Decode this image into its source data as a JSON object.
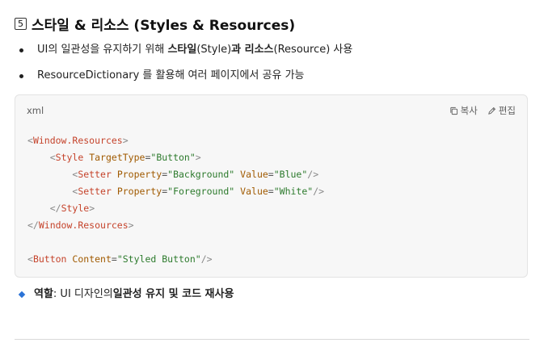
{
  "section": {
    "number": "5",
    "title": "스타일 & 리소스 (Styles & Resources)"
  },
  "bullets": [
    {
      "pre": "UI의 일관성을 유지하기 위해 ",
      "bold": "스타일",
      "mid1": "(Style)",
      "and": "과 ",
      "bold2": "리소스",
      "post": "(Resource) 사용"
    },
    {
      "text": "ResourceDictionary 를 활용해 여러 페이지에서 공유 가능"
    }
  ],
  "code": {
    "language": "xml",
    "copy_label": "복사",
    "edit_label": "편집",
    "lines": [
      {
        "indent": "",
        "open": "<",
        "tag": "Window.Resources",
        "close": ">"
      },
      {
        "indent": "    ",
        "open": "<",
        "tag": "Style",
        "attrs": [
          {
            "name": "TargetType",
            "value": "\"Button\""
          }
        ],
        "close": ">"
      },
      {
        "indent": "        ",
        "open": "<",
        "tag": "Setter",
        "attrs": [
          {
            "name": "Property",
            "value": "\"Background\""
          },
          {
            "name": "Value",
            "value": "\"Blue\""
          }
        ],
        "close": "/>"
      },
      {
        "indent": "        ",
        "open": "<",
        "tag": "Setter",
        "attrs": [
          {
            "name": "Property",
            "value": "\"Foreground\""
          },
          {
            "name": "Value",
            "value": "\"White\""
          }
        ],
        "close": "/>"
      },
      {
        "indent": "    ",
        "open": "</",
        "tag": "Style",
        "close": ">"
      },
      {
        "indent": "",
        "open": "</",
        "tag": "Window.Resources",
        "close": ">"
      },
      {
        "indent": "",
        "blank": true
      },
      {
        "indent": "",
        "open": "<",
        "tag": "Button",
        "attrs": [
          {
            "name": "Content",
            "value": "\"Styled Button\""
          }
        ],
        "close": "/>"
      }
    ]
  },
  "role": {
    "label": "역할",
    "colon": ": UI 디자인의 ",
    "bold": "일관성 유지 및 코드 재사용"
  },
  "colors": {
    "tag": "#c5432b",
    "attr": "#a05a00",
    "value": "#2c7a2c",
    "diamond": "#2b73d6"
  }
}
